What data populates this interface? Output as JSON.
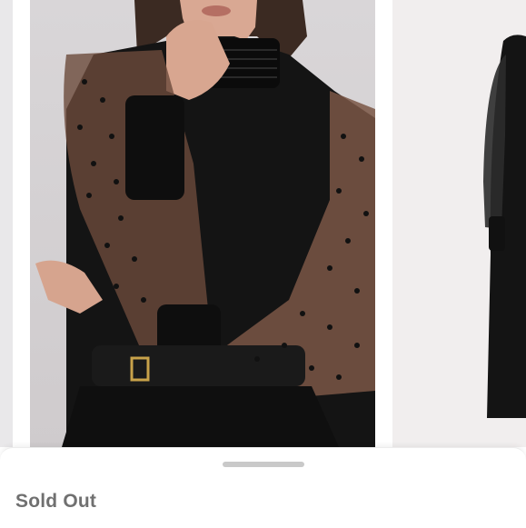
{
  "product": {
    "status_text": "Sold Out"
  },
  "carousel": {
    "images": [
      {
        "name": "previous-product-image"
      },
      {
        "name": "model-wearing-black-dobby-sleeve-top"
      },
      {
        "name": "black-dress-product-image"
      }
    ]
  },
  "colors": {
    "background": "#ffffff",
    "status_text": "#707070",
    "handle": "#c9c9c9"
  }
}
